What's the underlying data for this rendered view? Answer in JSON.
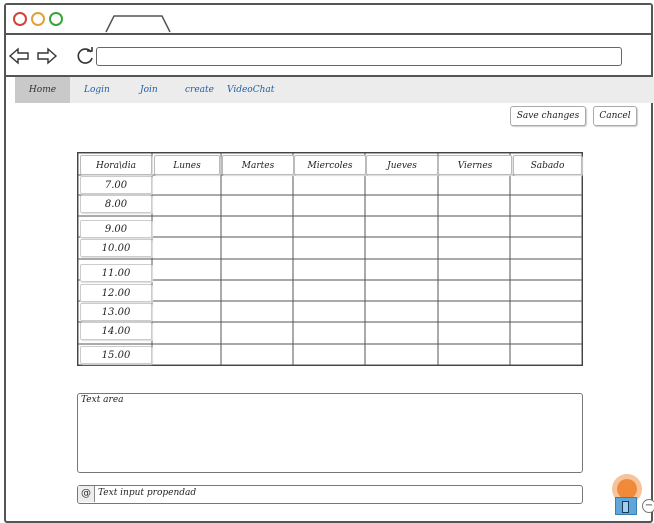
{
  "browser": {
    "url_value": "",
    "icons": {
      "back": "arrow-left-icon",
      "forward": "arrow-right-icon",
      "reload": "reload-icon"
    }
  },
  "menu": {
    "items": [
      {
        "label": "Home"
      },
      {
        "label": "Login"
      },
      {
        "label": "Join"
      },
      {
        "label": "create"
      },
      {
        "label": "VideoChat"
      }
    ]
  },
  "actions": {
    "save_label": "Save changes",
    "cancel_label": "Cancel"
  },
  "schedule": {
    "corner_label": "Hora\\dia",
    "days": [
      "Lunes",
      "Martes",
      "Miercoles",
      "Jueves",
      "Viernes",
      "Sabado"
    ],
    "hours": [
      "7.00",
      "8.00",
      "9.00",
      "10.00",
      "11.00",
      "12.00",
      "13.00",
      "14.00",
      "15.00"
    ]
  },
  "text_area": {
    "label": "Text area"
  },
  "property_input": {
    "label": "Text input propendad"
  },
  "colors": {
    "accent_link": "#1f5fa8",
    "cursor": "#f08a3a",
    "mobile_toggle": "#5fa6d9"
  }
}
